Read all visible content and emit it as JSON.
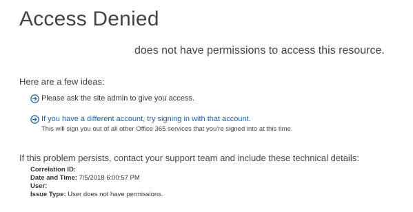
{
  "page": {
    "title": "Access Denied",
    "denied_message": "does not have permissions to access this resource."
  },
  "ideas": {
    "heading": "Here are a few ideas:",
    "items": [
      {
        "text": "Please ask the site admin to give you access.",
        "icon": "circle-arrow-right-icon",
        "is_link": false
      },
      {
        "text": "If you have a different account, try signing in with that account.",
        "icon": "circle-arrow-right-icon",
        "is_link": true,
        "note": "This will sign you out of all other Office 365 services that you're signed into at this time."
      }
    ]
  },
  "support": {
    "persists_text": "If this problem persists, contact your support team and include these technical details:"
  },
  "details": {
    "correlation_label": "Correlation ID:",
    "correlation_value": "",
    "datetime_label": "Date and Time:",
    "datetime_value": "7/5/2018 6:00:57 PM",
    "user_label": "User:",
    "user_value": "",
    "issue_label": "Issue Type:",
    "issue_value": "User does not have permissions."
  },
  "colors": {
    "link": "#1f5fa8",
    "text": "#333333",
    "title": "#444444",
    "icon": "#1f5fa8"
  }
}
